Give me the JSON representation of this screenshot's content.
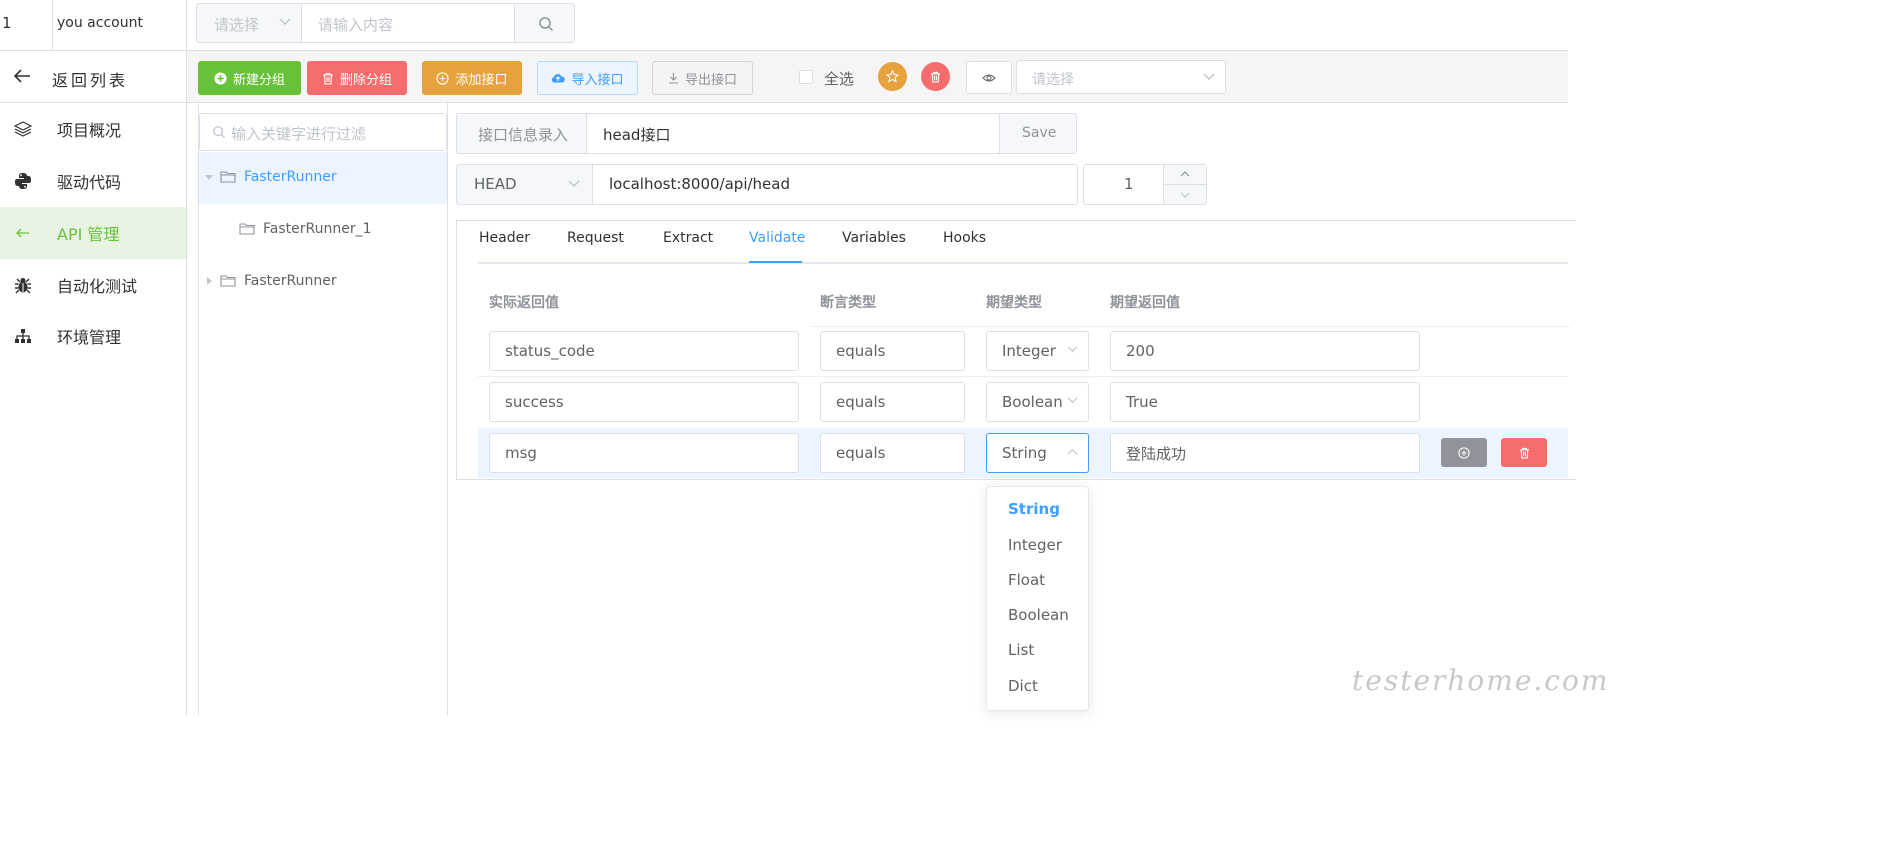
{
  "top": {
    "index": "1",
    "account": "you account",
    "search_select_placeholder": "请选择",
    "search_input_placeholder": "请输入内容"
  },
  "sidebar": {
    "back_label": "返回列表",
    "items": [
      {
        "label": "项目概况",
        "icon": "layers-icon"
      },
      {
        "label": "驱动代码",
        "icon": "python-icon"
      },
      {
        "label": "API 管理",
        "icon": "api-icon",
        "active": true
      },
      {
        "label": "自动化测试",
        "icon": "bug-icon"
      },
      {
        "label": "环境管理",
        "icon": "sitemap-icon"
      }
    ]
  },
  "toolbar": {
    "new_group": "新建分组",
    "delete_group": "删除分组",
    "add_api": "添加接口",
    "import_api": "导入接口",
    "export_api": "导出接口",
    "select_all": "全选",
    "select_placeholder": "请选择"
  },
  "tree": {
    "filter_placeholder": "输入关键字进行过滤",
    "nodes": [
      "FasterRunner",
      "FasterRunner_1",
      "FasterRunner"
    ]
  },
  "api": {
    "info_label": "接口信息录入",
    "name": "head接口",
    "save": "Save",
    "method": "HEAD",
    "url": "localhost:8000/api/head",
    "count": "1"
  },
  "tabs": [
    "Header",
    "Request",
    "Extract",
    "Validate",
    "Variables",
    "Hooks"
  ],
  "validate": {
    "headers": [
      "实际返回值",
      "断言类型",
      "期望类型",
      "期望返回值"
    ],
    "rows": [
      {
        "actual": "status_code",
        "comparator": "equals",
        "type": "Integer",
        "expected": "200"
      },
      {
        "actual": "success",
        "comparator": "equals",
        "type": "Boolean",
        "expected": "True"
      },
      {
        "actual": "msg",
        "comparator": "equals",
        "type": "String",
        "expected": "登陆成功"
      }
    ]
  },
  "type_dropdown": {
    "options": [
      "String",
      "Integer",
      "Float",
      "Boolean",
      "List",
      "Dict"
    ],
    "selected": "String"
  },
  "watermark": "testerhome.com",
  "colors": {
    "primary": "#409eff",
    "success": "#67c23a",
    "danger": "#f56c6c",
    "warning": "#e6a23c",
    "info": "#909399"
  }
}
